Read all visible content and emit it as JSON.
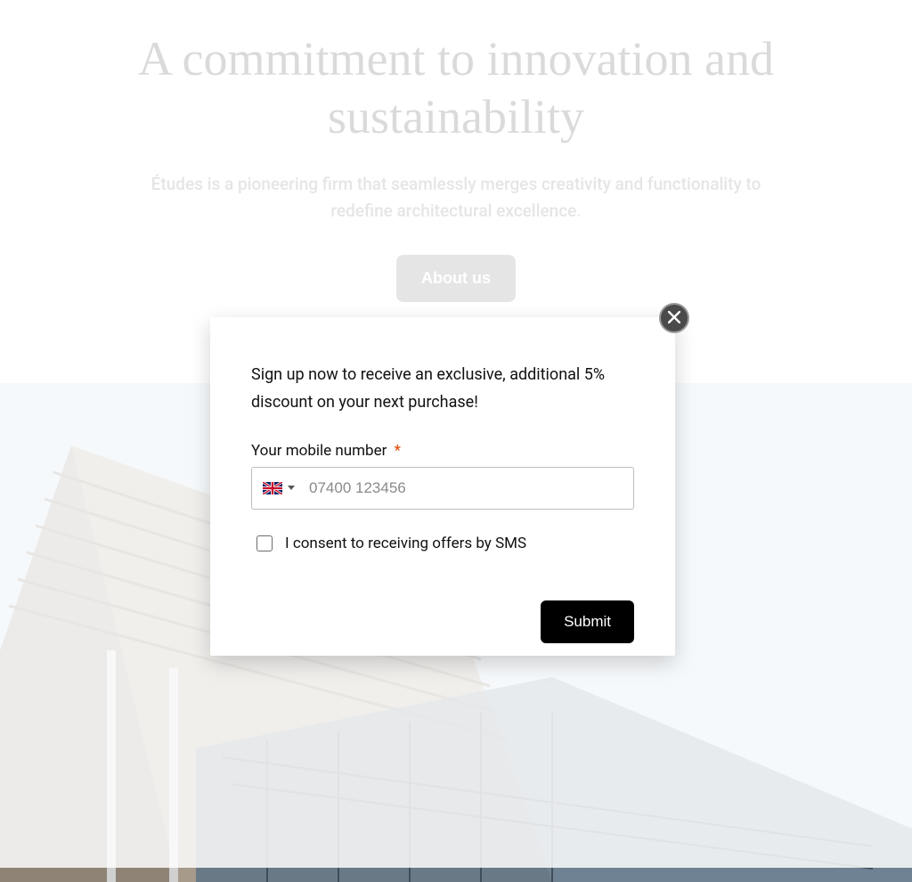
{
  "hero": {
    "title": "A commitment to innovation and sustainability",
    "subtitle": "Études is a pioneering firm that seamlessly merges creativity and functionality to redefine architectural excellence.",
    "about_button": "About us"
  },
  "modal": {
    "heading": "Sign up now to receive an exclusive, additional 5% discount on your next purchase!",
    "phone_label": "Your mobile number",
    "required_marker": "*",
    "phone_placeholder": "07400 123456",
    "country_code": "GB",
    "consent_label": "I consent to receiving offers by SMS",
    "submit_label": "Submit"
  }
}
